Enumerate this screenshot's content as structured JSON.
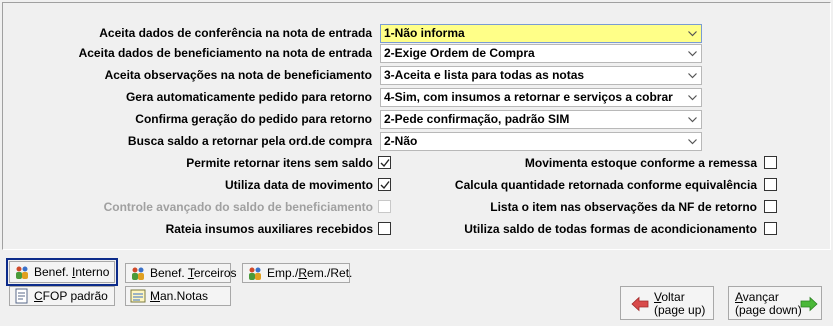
{
  "settings": [
    {
      "label": "Aceita dados de conferência na nota de entrada",
      "value": "1-Não informa"
    },
    {
      "label": "Aceita dados de beneficiamento na nota de entrada",
      "value": "2-Exige Ordem de Compra"
    },
    {
      "label": "Aceita observações na nota de beneficiamento",
      "value": "3-Aceita e lista para todas as notas"
    },
    {
      "label": "Gera automaticamente pedido para retorno",
      "value": "4-Sim, com insumos a retornar e serviços a cobrar"
    },
    {
      "label": "Confirma geração do pedido para retorno",
      "value": "2-Pede confirmação, padrão SIM"
    },
    {
      "label": "Busca saldo a retornar pela ord.de compra",
      "value": "2-Não"
    }
  ],
  "left_checks": [
    {
      "label": "Permite retornar itens sem saldo",
      "checked": true,
      "enabled": true
    },
    {
      "label": "Utiliza data de movimento",
      "checked": true,
      "enabled": true
    },
    {
      "label": "Controle avançado do saldo de beneficiamento",
      "checked": false,
      "enabled": false
    },
    {
      "label": "Rateia insumos auxiliares recebidos",
      "checked": false,
      "enabled": true
    }
  ],
  "right_checks": [
    {
      "label": "Movimenta estoque conforme a remessa",
      "checked": false
    },
    {
      "label": "Calcula quantidade retornada conforme equivalência",
      "checked": false
    },
    {
      "label": "Lista o item nas observações da NF de retorno",
      "checked": false
    },
    {
      "label": "Utiliza saldo de todas formas de acondicionamento",
      "checked": false
    }
  ],
  "buttons": {
    "benef_interno": {
      "pre": "Benef. ",
      "key": "I",
      "post": "nterno"
    },
    "benef_terceiros": {
      "pre": "Benef. ",
      "key": "T",
      "post": "erceiros"
    },
    "emp_rem_ret": {
      "pre": "Emp./",
      "key": "R",
      "post": "em./Ret."
    },
    "cfop": {
      "pre": "",
      "key": "C",
      "post": "FOP padrão"
    },
    "man_notas": {
      "pre": "",
      "key": "M",
      "post": "an.Notas"
    },
    "voltar": {
      "line1_key": "V",
      "line1": "oltar",
      "line2": "(page up)"
    },
    "avancar": {
      "line1_key": "A",
      "line1": "vançar",
      "line2": "(page down)"
    }
  }
}
